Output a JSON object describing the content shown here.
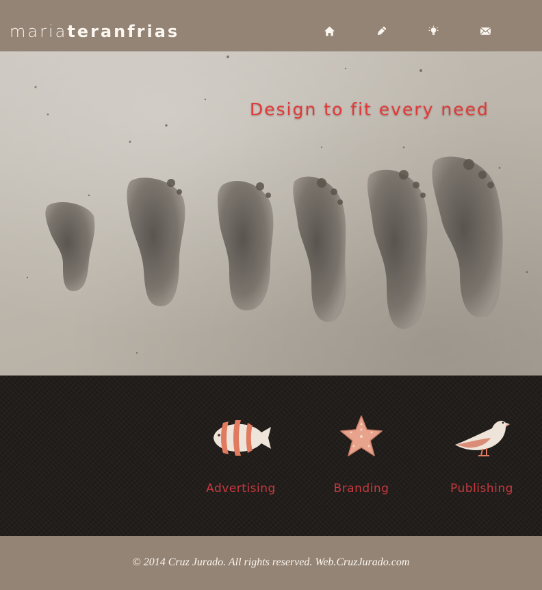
{
  "header": {
    "logo_light": "maria",
    "logo_bold": "teranfrias",
    "nav": [
      {
        "icon": "home-icon"
      },
      {
        "icon": "pencil-icon"
      },
      {
        "icon": "lightbulb-icon"
      },
      {
        "icon": "envelope-icon"
      }
    ]
  },
  "hero": {
    "title": "Design to fit every need"
  },
  "services": {
    "items": [
      {
        "label": "Advertising",
        "icon": "fish-icon"
      },
      {
        "label": "Branding",
        "icon": "starfish-icon"
      },
      {
        "label": "Publishing",
        "icon": "seagull-icon"
      }
    ]
  },
  "footer": {
    "copyright": "© 2014 Cruz Jurado. All rights reserved. Web.CruzJurado.com"
  },
  "colors": {
    "header_bg": "#948475",
    "accent": "#e03a3a",
    "dark_band": "#211d1a",
    "text_light": "#fbf6ef"
  }
}
